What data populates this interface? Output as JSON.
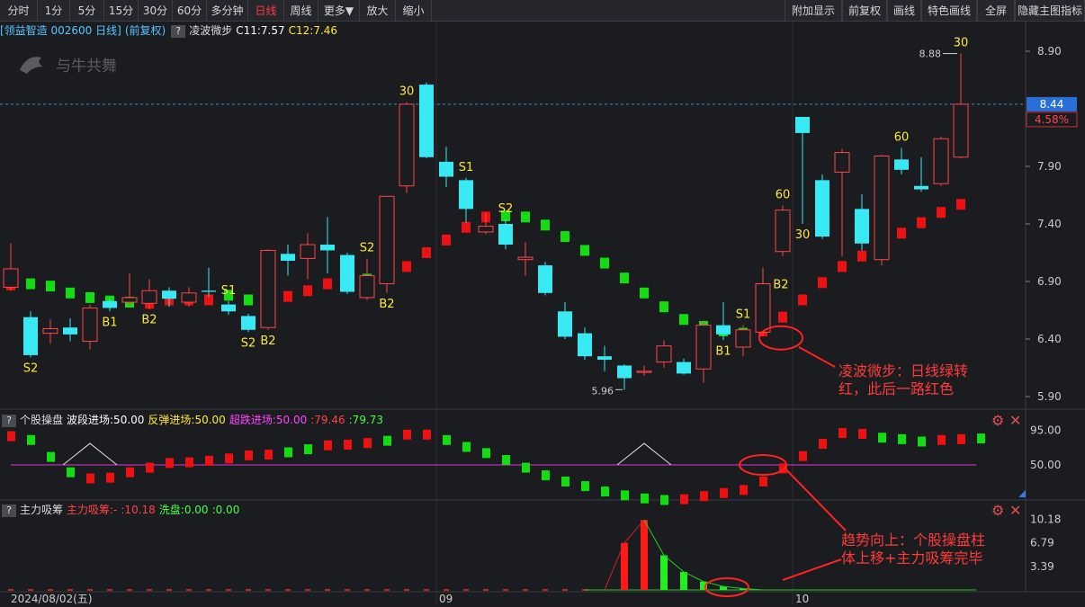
{
  "toolbar": {
    "left": [
      "分时",
      "1分",
      "5分",
      "15分",
      "30分",
      "60分",
      "多分钟",
      "日线",
      "周线",
      "更多▼",
      "放大",
      "缩小"
    ],
    "active": "日线",
    "right": [
      "附加显示",
      "前复权",
      "画线",
      "特色画线",
      "全屏",
      "隐藏主图指标"
    ]
  },
  "header": {
    "stock": "[领益智造 002600 日线]",
    "adj": "(前复权)",
    "q": "?",
    "indicator": "凌波微步",
    "c11": "C11:7.57",
    "c12": "C12:7.46"
  },
  "logo": "与牛共舞",
  "main_axis": {
    "ticks": [
      8.9,
      7.9,
      7.4,
      6.9,
      6.4,
      5.9
    ],
    "tick_labels": [
      "8.90",
      "7.90",
      "7.40",
      "6.90",
      "6.40",
      "5.90"
    ],
    "price_tag": "8.44",
    "pct_tag": "4.58%",
    "max_label": "8.88",
    "min_label": "5.96"
  },
  "candles": [
    {
      "o": 6.85,
      "c": 7.01,
      "h": 7.23,
      "l": 6.82
    },
    {
      "o": 6.59,
      "c": 6.26,
      "h": 6.64,
      "l": 6.24
    },
    {
      "o": 6.45,
      "c": 6.49,
      "h": 6.57,
      "l": 6.36
    },
    {
      "o": 6.5,
      "c": 6.44,
      "h": 6.58,
      "l": 6.38
    },
    {
      "o": 6.38,
      "c": 6.67,
      "h": 6.7,
      "l": 6.31
    },
    {
      "o": 6.73,
      "c": 6.67,
      "h": 6.75,
      "l": 6.64
    },
    {
      "o": 6.72,
      "c": 6.76,
      "h": 6.97,
      "l": 6.68
    },
    {
      "o": 6.71,
      "c": 6.82,
      "h": 6.92,
      "l": 6.66
    },
    {
      "o": 6.82,
      "c": 6.75,
      "h": 6.85,
      "l": 6.68
    },
    {
      "o": 6.72,
      "c": 6.8,
      "h": 6.85,
      "l": 6.68
    },
    {
      "o": 6.82,
      "c": 6.81,
      "h": 7.02,
      "l": 6.77
    },
    {
      "o": 6.7,
      "c": 6.64,
      "h": 6.73,
      "l": 6.61
    },
    {
      "o": 6.6,
      "c": 6.48,
      "h": 6.62,
      "l": 6.46
    },
    {
      "o": 6.5,
      "c": 7.17,
      "h": 7.18,
      "l": 6.48
    },
    {
      "o": 7.14,
      "c": 7.08,
      "h": 7.22,
      "l": 6.95
    },
    {
      "o": 7.1,
      "c": 7.22,
      "h": 7.32,
      "l": 6.92
    },
    {
      "o": 7.22,
      "c": 7.17,
      "h": 7.46,
      "l": 6.97
    },
    {
      "o": 7.13,
      "c": 6.81,
      "h": 7.15,
      "l": 6.79
    },
    {
      "o": 6.76,
      "c": 6.95,
      "h": 7.1,
      "l": 6.74
    },
    {
      "o": 6.88,
      "c": 7.64,
      "h": 7.64,
      "l": 6.8
    },
    {
      "o": 7.73,
      "c": 8.44,
      "h": 8.46,
      "l": 7.67
    },
    {
      "o": 8.61,
      "c": 7.98,
      "h": 8.63,
      "l": 7.97
    },
    {
      "o": 7.94,
      "c": 7.81,
      "h": 8.07,
      "l": 7.72
    },
    {
      "o": 7.78,
      "c": 7.53,
      "h": 7.8,
      "l": 7.41
    },
    {
      "o": 7.33,
      "c": 7.38,
      "h": 7.5,
      "l": 7.31
    },
    {
      "o": 7.4,
      "c": 7.22,
      "h": 7.44,
      "l": 7.18
    },
    {
      "o": 7.09,
      "c": 7.11,
      "h": 7.24,
      "l": 6.95
    },
    {
      "o": 7.04,
      "c": 6.8,
      "h": 7.07,
      "l": 6.78
    },
    {
      "o": 6.64,
      "c": 6.42,
      "h": 6.72,
      "l": 6.4
    },
    {
      "o": 6.45,
      "c": 6.25,
      "h": 6.5,
      "l": 6.22
    },
    {
      "o": 6.25,
      "c": 6.22,
      "h": 6.34,
      "l": 6.12
    },
    {
      "o": 6.17,
      "c": 6.06,
      "h": 6.18,
      "l": 5.96
    },
    {
      "o": 6.11,
      "c": 6.12,
      "h": 6.17,
      "l": 6.08
    },
    {
      "o": 6.2,
      "c": 6.34,
      "h": 6.39,
      "l": 6.15
    },
    {
      "o": 6.2,
      "c": 6.1,
      "h": 6.23,
      "l": 6.09
    },
    {
      "o": 6.14,
      "c": 6.52,
      "h": 6.56,
      "l": 6.02
    },
    {
      "o": 6.52,
      "c": 6.44,
      "h": 6.72,
      "l": 6.39
    },
    {
      "o": 6.33,
      "c": 6.48,
      "h": 6.52,
      "l": 6.25
    },
    {
      "o": 6.46,
      "c": 6.88,
      "h": 7.02,
      "l": 6.43
    },
    {
      "o": 7.16,
      "c": 7.52,
      "h": 7.56,
      "l": 7.12
    },
    {
      "o": 8.33,
      "c": 8.19,
      "h": 8.33,
      "l": 7.4
    },
    {
      "o": 7.78,
      "c": 7.29,
      "h": 7.83,
      "l": 7.27
    },
    {
      "o": 7.85,
      "c": 8.02,
      "h": 8.05,
      "l": 7.12
    },
    {
      "o": 7.53,
      "c": 7.23,
      "h": 7.66,
      "l": 7.17
    },
    {
      "o": 7.09,
      "c": 7.99,
      "h": 8.0,
      "l": 7.04
    },
    {
      "o": 7.96,
      "c": 7.87,
      "h": 8.06,
      "l": 7.83
    },
    {
      "o": 7.73,
      "c": 7.7,
      "h": 7.98,
      "l": 7.68
    },
    {
      "o": 7.75,
      "c": 8.14,
      "h": 8.16,
      "l": 7.73
    },
    {
      "o": 7.98,
      "c": 8.44,
      "h": 8.88,
      "l": 7.97
    }
  ],
  "wave": [
    {
      "i": 0,
      "v": 6.87,
      "c": "red"
    },
    {
      "i": 1,
      "v": 6.88,
      "c": "green"
    },
    {
      "i": 2,
      "v": 6.86,
      "c": "green"
    },
    {
      "i": 3,
      "v": 6.8,
      "c": "green"
    },
    {
      "i": 4,
      "v": 6.76,
      "c": "green"
    },
    {
      "i": 5,
      "v": 6.73,
      "c": "green"
    },
    {
      "i": 6,
      "v": 6.72,
      "c": "green"
    },
    {
      "i": 7,
      "v": 6.71,
      "c": "red"
    },
    {
      "i": 8,
      "v": 6.74,
      "c": "red"
    },
    {
      "i": 9,
      "v": 6.74,
      "c": "red"
    },
    {
      "i": 10,
      "v": 6.74,
      "c": "red"
    },
    {
      "i": 11,
      "v": 6.78,
      "c": "green"
    },
    {
      "i": 12,
      "v": 6.74,
      "c": "green"
    },
    {
      "i": 13,
      "v": 6.77,
      "c": "red"
    },
    {
      "i": 14,
      "v": 6.77,
      "c": "red"
    },
    {
      "i": 15,
      "v": 6.82,
      "c": "red"
    },
    {
      "i": 16,
      "v": 6.88,
      "c": "red"
    },
    {
      "i": 17,
      "v": 6.91,
      "c": "red"
    },
    {
      "i": 18,
      "v": 6.92,
      "c": "green"
    },
    {
      "i": 19,
      "v": 6.95,
      "c": "red"
    },
    {
      "i": 20,
      "v": 7.03,
      "c": "red"
    },
    {
      "i": 21,
      "v": 7.15,
      "c": "red"
    },
    {
      "i": 22,
      "v": 7.26,
      "c": "red"
    },
    {
      "i": 23,
      "v": 7.37,
      "c": "red"
    },
    {
      "i": 24,
      "v": 7.46,
      "c": "red"
    },
    {
      "i": 25,
      "v": 7.47,
      "c": "green"
    },
    {
      "i": 26,
      "v": 7.46,
      "c": "green"
    },
    {
      "i": 27,
      "v": 7.39,
      "c": "green"
    },
    {
      "i": 28,
      "v": 7.29,
      "c": "green"
    },
    {
      "i": 29,
      "v": 7.17,
      "c": "green"
    },
    {
      "i": 30,
      "v": 7.06,
      "c": "green"
    },
    {
      "i": 31,
      "v": 6.93,
      "c": "green"
    },
    {
      "i": 32,
      "v": 6.8,
      "c": "green"
    },
    {
      "i": 33,
      "v": 6.68,
      "c": "green"
    },
    {
      "i": 34,
      "v": 6.57,
      "c": "green"
    },
    {
      "i": 35,
      "v": 6.51,
      "c": "green"
    },
    {
      "i": 36,
      "v": 6.47,
      "c": "green"
    },
    {
      "i": 37,
      "v": 6.45,
      "c": "green"
    },
    {
      "i": 38,
      "v": 6.47,
      "c": "red"
    },
    {
      "i": 39,
      "v": 6.59,
      "c": "red"
    },
    {
      "i": 40,
      "v": 6.74,
      "c": "red"
    },
    {
      "i": 41,
      "v": 6.89,
      "c": "red"
    },
    {
      "i": 42,
      "v": 7.03,
      "c": "red"
    },
    {
      "i": 43,
      "v": 7.12,
      "c": "red"
    },
    {
      "i": 44,
      "v": 7.23,
      "c": "red"
    },
    {
      "i": 45,
      "v": 7.32,
      "c": "red"
    },
    {
      "i": 46,
      "v": 7.41,
      "c": "red"
    },
    {
      "i": 47,
      "v": 7.5,
      "c": "red"
    },
    {
      "i": 48,
      "v": 7.57,
      "c": "red"
    }
  ],
  "signals": [
    {
      "i": 1,
      "t": "S2",
      "pos": "below"
    },
    {
      "i": 5,
      "t": "B1",
      "pos": "below"
    },
    {
      "i": 7,
      "t": "B2",
      "pos": "below"
    },
    {
      "i": 11,
      "t": "S1",
      "pos": "above"
    },
    {
      "i": 12,
      "t": "S2",
      "pos": "below"
    },
    {
      "i": 13,
      "t": "B2",
      "pos": "below"
    },
    {
      "i": 18,
      "t": "S2",
      "pos": "above"
    },
    {
      "i": 19,
      "t": "B2",
      "pos": "below"
    },
    {
      "i": 20,
      "t": "30",
      "pos": "above"
    },
    {
      "i": 23,
      "t": "S1",
      "pos": "above"
    },
    {
      "i": 25,
      "t": "S2",
      "pos": "above"
    },
    {
      "i": 36,
      "t": "B1",
      "pos": "below"
    },
    {
      "i": 37,
      "t": "S1",
      "pos": "above"
    },
    {
      "i": 38,
      "t": "B2",
      "pos": "right"
    },
    {
      "i": 39,
      "t": "60",
      "pos": "above"
    },
    {
      "i": 40,
      "t": "30",
      "pos": "below"
    },
    {
      "i": 45,
      "t": "60",
      "pos": "above"
    },
    {
      "i": 48,
      "t": "30",
      "pos": "above"
    }
  ],
  "annotation1": {
    "line1": "凌波微步：日线绿转",
    "line2": "红，此后一路红色"
  },
  "annotation2": {
    "line1": "趋势向上：个股操盘柱",
    "line2": "体上移+主力吸筹完毕"
  },
  "panel2": {
    "q": "?",
    "name": "个股操盘",
    "l1": "波段进场:50.00",
    "l2": "反弹进场:50.00",
    "l3": "超跌进场:50.00",
    "l4": ":79.46",
    "l5": ":79.73",
    "ticks": [
      "95.00",
      "50.00"
    ],
    "values": [
      88,
      83,
      61,
      41,
      33,
      34,
      41,
      47,
      53,
      54,
      56,
      59,
      63,
      64,
      67,
      71,
      76,
      77,
      79,
      82,
      90,
      90,
      83,
      74,
      66,
      57,
      47,
      37,
      29,
      23,
      16,
      11,
      7,
      5,
      6,
      10,
      14,
      18,
      29,
      46,
      62,
      78,
      92,
      91,
      86,
      84,
      81,
      83,
      84,
      85
    ],
    "colors": [
      "red",
      "green",
      "green",
      "green",
      "red",
      "red",
      "red",
      "red",
      "red",
      "red",
      "red",
      "red",
      "red",
      "red",
      "green",
      "green",
      "red",
      "red",
      "red",
      "green",
      "red",
      "red",
      "green",
      "green",
      "green",
      "green",
      "green",
      "green",
      "green",
      "green",
      "green",
      "green",
      "green",
      "green",
      "red",
      "red",
      "red",
      "red",
      "red",
      "red",
      "red",
      "red",
      "red",
      "red",
      "green",
      "green",
      "green",
      "red",
      "red",
      "green"
    ]
  },
  "panel3": {
    "q": "?",
    "name": "主力吸筹",
    "l1": "主力吸筹:-",
    "l2": ":10.18",
    "l3": "洗盘:0.00",
    "l4": ":0.00",
    "ticks": [
      "10.18",
      "6.79",
      "3.39"
    ],
    "values": [
      {
        "i": 31,
        "v": 6.8,
        "c": "red"
      },
      {
        "i": 32,
        "v": 10.1,
        "c": "red"
      },
      {
        "i": 33,
        "v": 5.0,
        "c": "green"
      },
      {
        "i": 34,
        "v": 2.6,
        "c": "green"
      },
      {
        "i": 35,
        "v": 1.2,
        "c": "green"
      },
      {
        "i": 36,
        "v": 0.5,
        "c": "green"
      },
      {
        "i": 37,
        "v": 0.2,
        "c": "green"
      }
    ]
  },
  "xaxis": {
    "first": "2024/08/02(五)",
    "m9": "09",
    "m10": "10"
  }
}
